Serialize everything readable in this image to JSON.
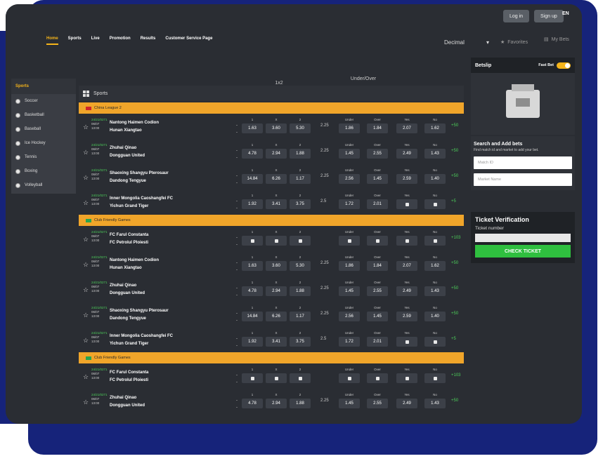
{
  "header": {
    "nav": [
      "Home",
      "Sports",
      "Live",
      "Promotion",
      "Results",
      "Customer Service Page"
    ],
    "login": "Log in",
    "signup": "Sign up",
    "lang": "EN",
    "odds_format": "Decimal",
    "favorites": "Favorites",
    "my_bets": "My Bets"
  },
  "sidebar": {
    "title": "Sports",
    "items": [
      "Soccer",
      "Basketball",
      "Baseball",
      "Ice Hockey",
      "Tennis",
      "Boxing",
      "Volleyball"
    ]
  },
  "table": {
    "col_1x2": "1x2",
    "col_uo": "Under/Over",
    "sports_label": "Sports",
    "leagues": [
      "China League 2",
      "Club Friendly Games",
      "Club Friendly Games"
    ]
  },
  "matches": [
    {
      "date": "24/21/0271",
      "dm": "06/07",
      "time": "13:00",
      "home": "Nantong Haimen Codion",
      "away": "Hunan Xiangtao",
      "o1": "1.63",
      "ox": "3.60",
      "o2": "5.30",
      "line": "2.25",
      "under": "1.86",
      "over": "1.84",
      "yes": "2.07",
      "no": "1.62",
      "more": "+50"
    },
    {
      "date": "24/21/0271",
      "dm": "06/07",
      "time": "13:00",
      "home": "Zhuhai Qinao",
      "away": "Dongguan United",
      "o1": "4.78",
      "ox": "2.94",
      "o2": "1.88",
      "line": "2.25",
      "under": "1.45",
      "over": "2.55",
      "yes": "2.49",
      "no": "1.43",
      "more": "+50"
    },
    {
      "date": "24/21/0271",
      "dm": "06/07",
      "time": "13:00",
      "home": "Shaoxing Shangyu Pterosaur",
      "away": "Dandong Tengyue",
      "o1": "14.84",
      "ox": "6.26",
      "o2": "1.17",
      "line": "2.25",
      "under": "2.56",
      "over": "1.45",
      "yes": "2.59",
      "no": "1.40",
      "more": "+50"
    },
    {
      "date": "24/21/0271",
      "dm": "06/07",
      "time": "13:00",
      "home": "Inner Mongolia Caoshangfei FC",
      "away": "Yichun Grand Tiger",
      "o1": "1.92",
      "ox": "3.41",
      "o2": "3.75",
      "line": "2.5",
      "under": "1.72",
      "over": "2.01",
      "yes": "",
      "no": "",
      "more": "+5"
    },
    {
      "date": "24/21/0271",
      "dm": "06/07",
      "time": "13:00",
      "home": "FC Farul Constanta",
      "away": "FC Petrolul Ploiesti",
      "o1": "",
      "ox": "",
      "o2": "",
      "line": "",
      "under": "",
      "over": "",
      "yes": "",
      "no": "",
      "more": "+103"
    },
    {
      "date": "24/21/0271",
      "dm": "06/07",
      "time": "13:00",
      "home": "Nantong Haimen Codion",
      "away": "Hunan Xiangtao",
      "o1": "1.63",
      "ox": "3.60",
      "o2": "5.30",
      "line": "2.25",
      "under": "1.86",
      "over": "1.84",
      "yes": "2.07",
      "no": "1.62",
      "more": "+50"
    },
    {
      "date": "24/21/0271",
      "dm": "06/07",
      "time": "13:00",
      "home": "Zhuhai Qinao",
      "away": "Dongguan United",
      "o1": "4.78",
      "ox": "2.94",
      "o2": "1.88",
      "line": "2.25",
      "under": "1.45",
      "over": "2.55",
      "yes": "2.49",
      "no": "1.43",
      "more": "+50"
    },
    {
      "date": "24/21/0271",
      "dm": "06/07",
      "time": "13:00",
      "home": "Shaoxing Shangyu Pterosaur",
      "away": "Dandong Tengyue",
      "o1": "14.84",
      "ox": "6.26",
      "o2": "1.17",
      "line": "2.25",
      "under": "2.56",
      "over": "1.45",
      "yes": "2.59",
      "no": "1.40",
      "more": "+50"
    },
    {
      "date": "24/21/0271",
      "dm": "06/07",
      "time": "13:00",
      "home": "Inner Mongolia Caoshangfei FC",
      "away": "Yichun Grand Tiger",
      "o1": "1.92",
      "ox": "3.41",
      "o2": "3.75",
      "line": "2.5",
      "under": "1.72",
      "over": "2.01",
      "yes": "",
      "no": "",
      "more": "+5"
    },
    {
      "date": "24/21/0271",
      "dm": "06/07",
      "time": "13:00",
      "home": "FC Farul Constanta",
      "away": "FC Petrolul Ploiesti",
      "o1": "",
      "ox": "",
      "o2": "",
      "line": "",
      "under": "",
      "over": "",
      "yes": "",
      "no": "",
      "more": "+103"
    },
    {
      "date": "24/21/0271",
      "dm": "06/07",
      "time": "13:00",
      "home": "Zhuhai Qinao",
      "away": "Dongguan United",
      "o1": "4.78",
      "ox": "2.94",
      "o2": "1.88",
      "line": "2.25",
      "under": "1.45",
      "over": "2.55",
      "yes": "2.49",
      "no": "1.43",
      "more": "+50"
    }
  ],
  "labels": {
    "one": "1",
    "x": "X",
    "two": "2",
    "under": "Under",
    "over": "Over",
    "yes": "Yes",
    "no": "No"
  },
  "betslip": {
    "title": "Betslip",
    "fast_bet": "Fast Bet",
    "search_title": "Search and Add bets",
    "search_sub": "Find match id and market to add your bet.",
    "match_id_placeholder": "Match ID",
    "market_placeholder": "Market Name",
    "ticket_title": "Ticket Verification",
    "ticket_number": "Ticket number",
    "check_ticket": "CHECK TICKET"
  },
  "colors": {
    "accent": "#f5b41a",
    "league_bar": "#f0a52a",
    "green": "#2fbf3f",
    "bg": "#2a2d33",
    "frame": "#16237a"
  }
}
